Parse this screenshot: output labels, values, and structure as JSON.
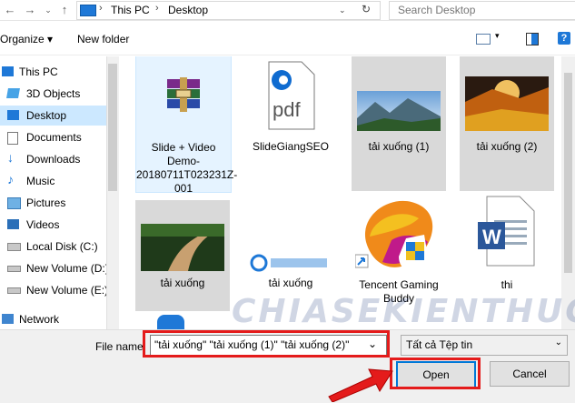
{
  "address_bar": {
    "crumbs": [
      "This PC",
      "Desktop"
    ],
    "search_placeholder": "Search Desktop"
  },
  "toolbar": {
    "organize_label": "Organize",
    "new_folder_label": "New folder"
  },
  "sidebar": {
    "items": [
      {
        "label": "This PC",
        "icon": "pc-icon"
      },
      {
        "label": "3D Objects",
        "icon": "cube-icon"
      },
      {
        "label": "Desktop",
        "icon": "desktop-icon",
        "selected": true
      },
      {
        "label": "Documents",
        "icon": "document-icon"
      },
      {
        "label": "Downloads",
        "icon": "download-icon"
      },
      {
        "label": "Music",
        "icon": "music-icon"
      },
      {
        "label": "Pictures",
        "icon": "pictures-icon"
      },
      {
        "label": "Videos",
        "icon": "videos-icon"
      },
      {
        "label": "Local Disk (C:)",
        "icon": "drive-icon"
      },
      {
        "label": "New Volume (D:)",
        "icon": "drive-icon"
      },
      {
        "label": "New Volume (E:)",
        "icon": "drive-icon"
      },
      {
        "label": "Network",
        "icon": "network-icon"
      }
    ]
  },
  "files": [
    {
      "label": "Slide + Video Demo-20180711T023231Z-001",
      "icon": "winrar-archive-icon"
    },
    {
      "label": "SlideGiangSEO",
      "icon": "pdf-edge-icon"
    },
    {
      "label": "tải xuống (1)",
      "icon": "image-thumbnail-mountain"
    },
    {
      "label": "tải xuống (2)",
      "icon": "image-thumbnail-autumn"
    },
    {
      "label": "tải xuống",
      "icon": "image-thumbnail-path"
    },
    {
      "label": "tải xuống",
      "icon": "image-thumbnail-logo"
    },
    {
      "label": "Tencent Gaming Buddy",
      "icon": "tencent-gaming-buddy-icon"
    },
    {
      "label": "thi",
      "icon": "word-document-icon"
    }
  ],
  "bottom": {
    "file_name_label": "File name:",
    "file_name_value": "\"tải xuống\" \"tải xuống (1)\" \"tải xuống (2)\"",
    "filter_value": "Tất cả Tệp tin",
    "open_label": "Open",
    "cancel_label": "Cancel"
  },
  "watermark": {
    "text": "CHIASEKIENTHUC",
    "subtext": "C H I A S E K I E N T H U C"
  },
  "colors": {
    "selection": "#cce8ff",
    "accent": "#0078d7",
    "annotation_red": "#e41b1b"
  }
}
